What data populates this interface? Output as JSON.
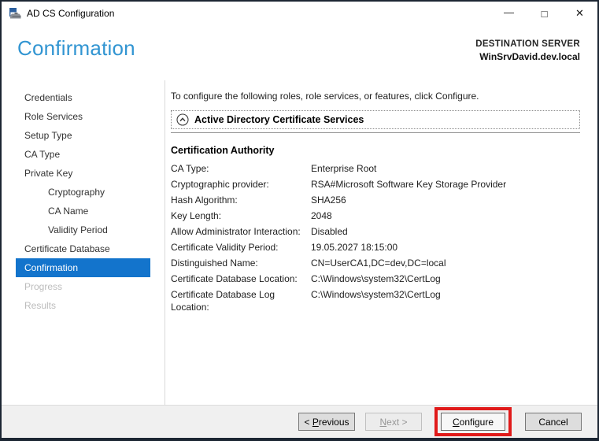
{
  "window": {
    "title": "AD CS Configuration",
    "controls": {
      "minimize": "—",
      "maximize": "□",
      "close": "✕"
    }
  },
  "header": {
    "page_title": "Confirmation",
    "destination_label": "DESTINATION SERVER",
    "destination_server": "WinSrvDavid.dev.local"
  },
  "sidebar": {
    "items": [
      {
        "label": "Credentials",
        "level": 0,
        "state": "enabled"
      },
      {
        "label": "Role Services",
        "level": 0,
        "state": "enabled"
      },
      {
        "label": "Setup Type",
        "level": 0,
        "state": "enabled"
      },
      {
        "label": "CA Type",
        "level": 0,
        "state": "enabled"
      },
      {
        "label": "Private Key",
        "level": 0,
        "state": "enabled"
      },
      {
        "label": "Cryptography",
        "level": 1,
        "state": "enabled"
      },
      {
        "label": "CA Name",
        "level": 1,
        "state": "enabled"
      },
      {
        "label": "Validity Period",
        "level": 1,
        "state": "enabled"
      },
      {
        "label": "Certificate Database",
        "level": 0,
        "state": "enabled"
      },
      {
        "label": "Confirmation",
        "level": 0,
        "state": "selected"
      },
      {
        "label": "Progress",
        "level": 0,
        "state": "disabled"
      },
      {
        "label": "Results",
        "level": 0,
        "state": "disabled"
      }
    ]
  },
  "content": {
    "intro": "To configure the following roles, role services, or features, click Configure.",
    "expander": {
      "label": "Active Directory Certificate Services",
      "icon": "chevron-up-circle",
      "expanded": true
    },
    "section_title": "Certification Authority",
    "details": [
      {
        "label": "CA Type:",
        "value": "Enterprise Root"
      },
      {
        "label": "Cryptographic provider:",
        "value": "RSA#Microsoft Software Key Storage Provider"
      },
      {
        "label": "Hash Algorithm:",
        "value": "SHA256"
      },
      {
        "label": "Key Length:",
        "value": "2048"
      },
      {
        "label": "Allow Administrator Interaction:",
        "value": "Disabled"
      },
      {
        "label": "Certificate Validity Period:",
        "value": "19.05.2027 18:15:00"
      },
      {
        "label": "Distinguished Name:",
        "value": "CN=UserCA1,DC=dev,DC=local"
      },
      {
        "label": "Certificate Database Location:",
        "value": "C:\\Windows\\system32\\CertLog"
      },
      {
        "label": "Certificate Database Log Location:",
        "value": "C:\\Windows\\system32\\CertLog"
      }
    ]
  },
  "footer": {
    "previous": {
      "pre": "< ",
      "key": "P",
      "post": "revious"
    },
    "next": {
      "pre": "",
      "key": "N",
      "post": "ext >"
    },
    "configure": {
      "pre": "",
      "key": "C",
      "post": "onfigure"
    },
    "cancel": {
      "label": "Cancel"
    }
  },
  "colors": {
    "window_border": "#1c2633",
    "page_title_blue": "#3295d2",
    "nav_selected_blue": "#1374cc",
    "annotation_red": "#e01a1a",
    "footer_gray": "#f0f0f0"
  }
}
